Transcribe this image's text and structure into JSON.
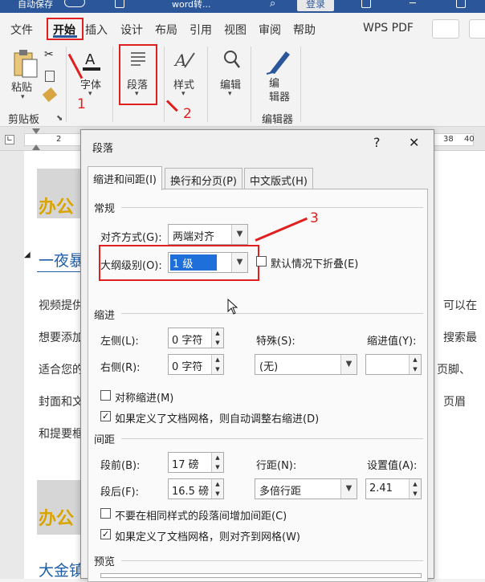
{
  "titlebar": {
    "autosave_label": "自动保存",
    "doc_name": "word转...",
    "login_label": "登录"
  },
  "ribbon": {
    "tabs": [
      "文件",
      "开始",
      "插入",
      "设计",
      "布局",
      "引用",
      "视图",
      "审阅",
      "帮助",
      "WPS PDF"
    ],
    "groups": {
      "paste": "粘贴",
      "clipboard": "剪贴板",
      "font": "字体",
      "paragraph": "段落",
      "styles": "样式",
      "editing": "编辑",
      "editor": "编\n辑器",
      "editor_group": "编辑器"
    }
  },
  "annotations": {
    "a1": "1",
    "a2": "2",
    "a3": "3"
  },
  "ruler": {
    "left_num": "2",
    "mark_38": "38",
    "mark_40": "40"
  },
  "document": {
    "heading1": "办公",
    "heading_blue1": "一夜暴",
    "p1_left": "视频提供",
    "p1_right": "可以在",
    "p2_left": "想要添加",
    "p2_right": "搜索最",
    "p3_left": "适合您的",
    "p3_right": "页脚、",
    "p4_left": "封面和文",
    "p4_right": "页眉",
    "p5_left": "和提要框",
    "heading2": "办公",
    "heading_blue2": "大金镇"
  },
  "dialog": {
    "title": "段落",
    "help_btn": "?",
    "close_btn": "✕",
    "tabs": [
      "缩进和间距(I)",
      "换行和分页(P)",
      "中文版式(H)"
    ],
    "general": {
      "section": "常规",
      "align_label": "对齐方式(G):",
      "align_value": "两端对齐",
      "outline_label": "大纲级别(O):",
      "outline_value": "1 级",
      "collapse_label": "默认情况下折叠(E)"
    },
    "indent": {
      "section": "缩进",
      "left_label": "左侧(L):",
      "left_value": "0 字符",
      "right_label": "右侧(R):",
      "right_value": "0 字符",
      "special_label": "特殊(S):",
      "special_value": "(无)",
      "by_label": "缩进值(Y):",
      "by_value": "",
      "mirror_label": "对称缩进(M)",
      "auto_adjust_label": "如果定义了文档网格，则自动调整右缩进(D)"
    },
    "spacing": {
      "section": "间距",
      "before_label": "段前(B):",
      "before_value": "17 磅",
      "after_label": "段后(F):",
      "after_value": "16.5 磅",
      "line_label": "行距(N):",
      "line_value": "多倍行距",
      "at_label": "设置值(A):",
      "at_value": "2.41",
      "no_space_label": "不要在相同样式的段落间增加间距(C)",
      "snap_label": "如果定义了文档网格，则对齐到网格(W)"
    },
    "preview": {
      "section": "预览"
    }
  }
}
